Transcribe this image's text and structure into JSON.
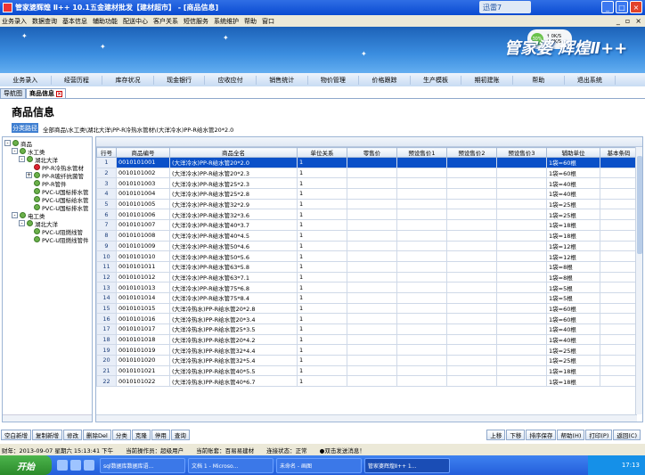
{
  "window": {
    "title": "管家婆辉煌 Ⅱ++ 10.1五金建材批发【建材超市】 - [商品信息]",
    "xunlei": "迅雷7"
  },
  "menu": [
    "业务录入",
    "数据查询",
    "基本信息",
    "辅助功能",
    "配送中心",
    "客户关系",
    "短信服务",
    "系统维护",
    "帮助",
    "窗口"
  ],
  "banner": {
    "brand": "管家婆 辉煌Ⅱ++",
    "net_up": "0K/S",
    "net_down": "0K/S",
    "net_pct": "30%"
  },
  "nav": [
    "业务录入",
    "经营历程",
    "库存状况",
    "现金银行",
    "应收应付",
    "销售统计",
    "物价管理",
    "价格跟踪",
    "生产模板",
    "期初建账",
    "帮助",
    "退出系统"
  ],
  "tabs": [
    "导航图",
    "商品信息"
  ],
  "page": {
    "title": "商品信息",
    "crumb_button": "分类路径",
    "breadcrumb": "全部商品\\水工类\\湖北大洋\\PP-R冷热水管材\\(大洋冷水)PP-R给水管20*2.0"
  },
  "tree": [
    {
      "label": "商品",
      "level": 0,
      "expand": "-"
    },
    {
      "label": "水工类",
      "level": 1,
      "expand": "-"
    },
    {
      "label": "湖北大洋",
      "level": 2,
      "expand": "-"
    },
    {
      "label": "PP-R冷热水管材",
      "level": 3,
      "expand": "",
      "selected": true
    },
    {
      "label": "PP-R玻纤抗菌管",
      "level": 3,
      "expand": "+"
    },
    {
      "label": "PP-R管件",
      "level": 3,
      "expand": ""
    },
    {
      "label": "PVC-U国标排水管",
      "level": 3,
      "expand": ""
    },
    {
      "label": "PVC-U国标给水管",
      "level": 3,
      "expand": ""
    },
    {
      "label": "PVC-U国标排水管",
      "level": 3,
      "expand": ""
    },
    {
      "label": "电工类",
      "level": 1,
      "expand": "-"
    },
    {
      "label": "湖北大洋",
      "level": 2,
      "expand": "-"
    },
    {
      "label": "PVC-U阻燃线管",
      "level": 3,
      "expand": ""
    },
    {
      "label": "PVC-U阻燃线管件",
      "level": 3,
      "expand": ""
    }
  ],
  "grid": {
    "headers": [
      "行号",
      "商品编号",
      "商品全名",
      "单位关系",
      "零售价",
      "预设售价1",
      "预设售价2",
      "预设售价3",
      "辅助单位",
      "基本条码"
    ],
    "rows": [
      [
        "1",
        "0010101001",
        "(大洋冷水)PP-R给水管20*2.0",
        "1",
        "",
        "",
        "",
        "",
        "1袋=60根",
        ""
      ],
      [
        "2",
        "0010101002",
        "(大洋冷水)PP-R给水管20*2.3",
        "1",
        "",
        "",
        "",
        "",
        "1袋=60根",
        ""
      ],
      [
        "3",
        "0010101003",
        "(大洋冷水)PP-R给水管25*2.3",
        "1",
        "",
        "",
        "",
        "",
        "1袋=40根",
        ""
      ],
      [
        "4",
        "0010101004",
        "(大洋冷水)PP-R给水管25*2.8",
        "1",
        "",
        "",
        "",
        "",
        "1袋=40根",
        ""
      ],
      [
        "5",
        "0010101005",
        "(大洋冷水)PP-R给水管32*2.9",
        "1",
        "",
        "",
        "",
        "",
        "1袋=25根",
        ""
      ],
      [
        "6",
        "0010101006",
        "(大洋冷水)PP-R给水管32*3.6",
        "1",
        "",
        "",
        "",
        "",
        "1袋=25根",
        ""
      ],
      [
        "7",
        "0010101007",
        "(大洋冷水)PP-R给水管40*3.7",
        "1",
        "",
        "",
        "",
        "",
        "1袋=18根",
        ""
      ],
      [
        "8",
        "0010101008",
        "(大洋冷水)PP-R给水管40*4.5",
        "1",
        "",
        "",
        "",
        "",
        "1袋=18根",
        ""
      ],
      [
        "9",
        "0010101009",
        "(大洋冷水)PP-R给水管50*4.6",
        "1",
        "",
        "",
        "",
        "",
        "1袋=12根",
        ""
      ],
      [
        "10",
        "0010101010",
        "(大洋冷水)PP-R给水管50*5.6",
        "1",
        "",
        "",
        "",
        "",
        "1袋=12根",
        ""
      ],
      [
        "11",
        "0010101011",
        "(大洋冷水)PP-R给水管63*5.8",
        "1",
        "",
        "",
        "",
        "",
        "1袋=8根",
        ""
      ],
      [
        "12",
        "0010101012",
        "(大洋冷水)PP-R给水管63*7.1",
        "1",
        "",
        "",
        "",
        "",
        "1袋=8根",
        ""
      ],
      [
        "13",
        "0010101013",
        "(大洋冷水)PP-R给水管75*6.8",
        "1",
        "",
        "",
        "",
        "",
        "1袋=5根",
        ""
      ],
      [
        "14",
        "0010101014",
        "(大洋冷水)PP-R给水管75*8.4",
        "1",
        "",
        "",
        "",
        "",
        "1袋=5根",
        ""
      ],
      [
        "15",
        "0010101015",
        "(大洋冷热水)PP-R给水管20*2.8",
        "1",
        "",
        "",
        "",
        "",
        "1袋=60根",
        ""
      ],
      [
        "16",
        "0010101016",
        "(大洋冷热水)PP-R给水管20*3.4",
        "1",
        "",
        "",
        "",
        "",
        "1袋=60根",
        ""
      ],
      [
        "17",
        "0010101017",
        "(大洋冷热水)PP-R给水管25*3.5",
        "1",
        "",
        "",
        "",
        "",
        "1袋=40根",
        ""
      ],
      [
        "18",
        "0010101018",
        "(大洋冷热水)PP-R给水管20*4.2",
        "1",
        "",
        "",
        "",
        "",
        "1袋=40根",
        ""
      ],
      [
        "19",
        "0010101019",
        "(大洋冷热水)PP-R给水管32*4.4",
        "1",
        "",
        "",
        "",
        "",
        "1袋=25根",
        ""
      ],
      [
        "20",
        "0010101020",
        "(大洋冷热水)PP-R给水管32*5.4",
        "1",
        "",
        "",
        "",
        "",
        "1袋=25根",
        ""
      ],
      [
        "21",
        "0010101021",
        "(大洋冷热水)PP-R给水管40*5.5",
        "1",
        "",
        "",
        "",
        "",
        "1袋=18根",
        ""
      ],
      [
        "22",
        "0010101022",
        "(大洋冷热水)PP-R给水管40*6.7",
        "1",
        "",
        "",
        "",
        "",
        "1袋=18根",
        ""
      ]
    ]
  },
  "buttons_left": [
    "空白新增",
    "复制新增",
    "修改",
    "删除Del",
    "分类",
    "克隆",
    "停用",
    "查询"
  ],
  "buttons_right": [
    "上移",
    "下移",
    "排序保存",
    "帮助(H)",
    "打印(P)",
    "返回(C)"
  ],
  "status": [
    "财年：2013-09-07 星期六 15:13:41 下午",
    "当前操作员：超级用户",
    "当前账套：百易易建材",
    "连接状态：正常",
    "●双击发送消息！"
  ],
  "taskbar": {
    "start": "开始",
    "items": [
      "sql数据库数据库语...",
      "文档 1 - Microso...",
      "未命名 - 画图",
      "管家婆辉煌Ⅱ++ 1..."
    ],
    "clock": "17:13"
  }
}
